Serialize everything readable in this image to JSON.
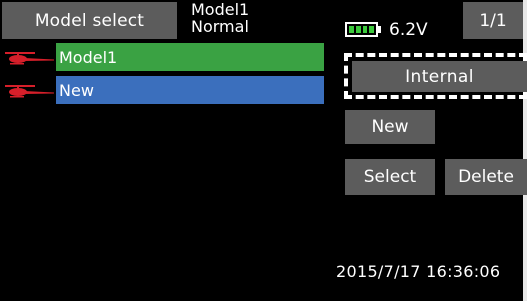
{
  "header": {
    "title": "Model select",
    "model_name": "Model1",
    "condition": "Normal",
    "battery_voltage": "6.2V",
    "battery_level": 1.0,
    "page_indicator": "1/1"
  },
  "model_list": {
    "items": [
      {
        "label": "Model1",
        "icon": "helicopter-icon",
        "highlight_color": "#3aa243"
      },
      {
        "label": "New",
        "icon": "helicopter-icon",
        "highlight_color": "#3b6fbd"
      }
    ]
  },
  "actions": {
    "storage_label": "Internal",
    "new_label": "New",
    "select_label": "Select",
    "delete_label": "Delete"
  },
  "status": {
    "datetime": "2015/7/17 16:36:06"
  },
  "colors": {
    "background": "#000000",
    "button": "#5c5c5c",
    "selected_green": "#3aa243",
    "selected_blue": "#3b6fbd",
    "icon_red": "#d61f2a",
    "battery_green": "#3cc93c"
  }
}
